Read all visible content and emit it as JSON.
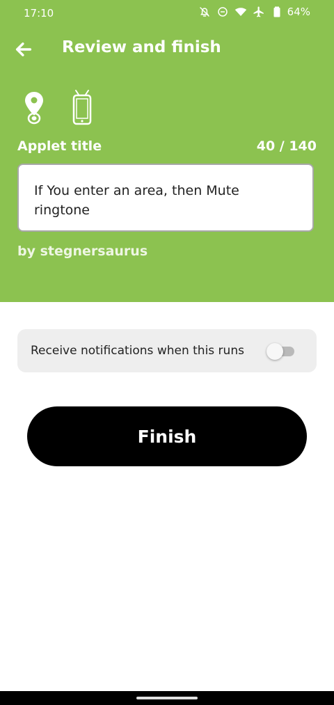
{
  "status_bar": {
    "time": "17:10",
    "battery_percent": "64%",
    "icons": [
      "notifications-off-icon",
      "do-not-disturb-icon",
      "wifi-icon",
      "airplane-icon",
      "battery-icon"
    ]
  },
  "header": {
    "title": "Review and finish",
    "back_icon": "arrow-left-icon",
    "service_icons": [
      "location-pin-icon",
      "android-phone-icon"
    ]
  },
  "applet": {
    "title_label": "Applet title",
    "char_count": "40 / 140",
    "title_value": "If You enter an area, then Mute ringtone",
    "byline": "by stegnersaurus"
  },
  "notifications": {
    "label": "Receive notifications when this runs",
    "enabled": false
  },
  "finish_button": {
    "label": "Finish"
  },
  "colors": {
    "header_bg": "#8cc250",
    "button_bg": "#000000",
    "card_bg": "#eeeeee"
  }
}
